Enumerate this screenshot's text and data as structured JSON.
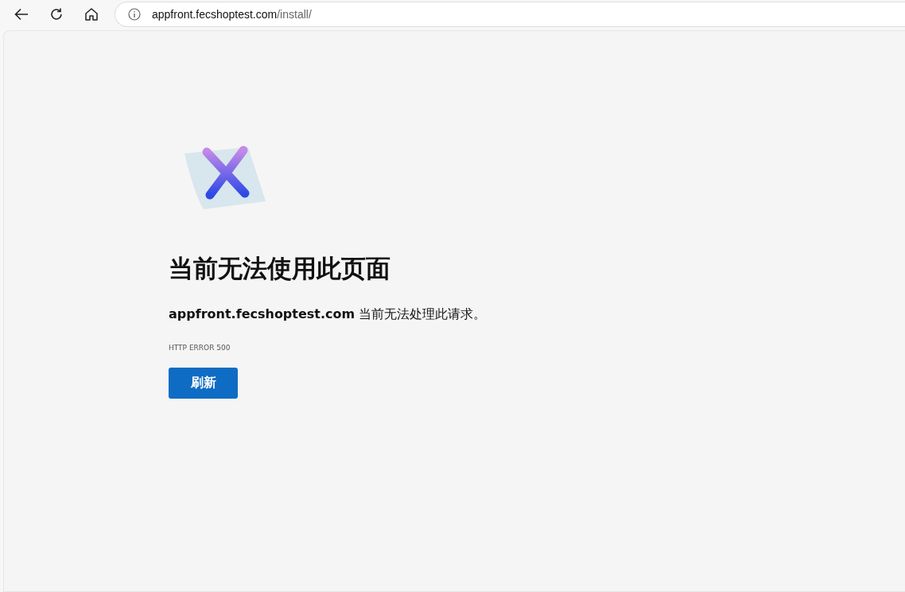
{
  "toolbar": {
    "address": {
      "host": "appfront.fecshoptest.com",
      "path": "/install/"
    }
  },
  "error_page": {
    "heading": "当前无法使用此页面",
    "message": "**appfront.fecshoptest.com** 当前无法处理此请求。",
    "code": "HTTP ERROR 500",
    "button": "刷新"
  }
}
